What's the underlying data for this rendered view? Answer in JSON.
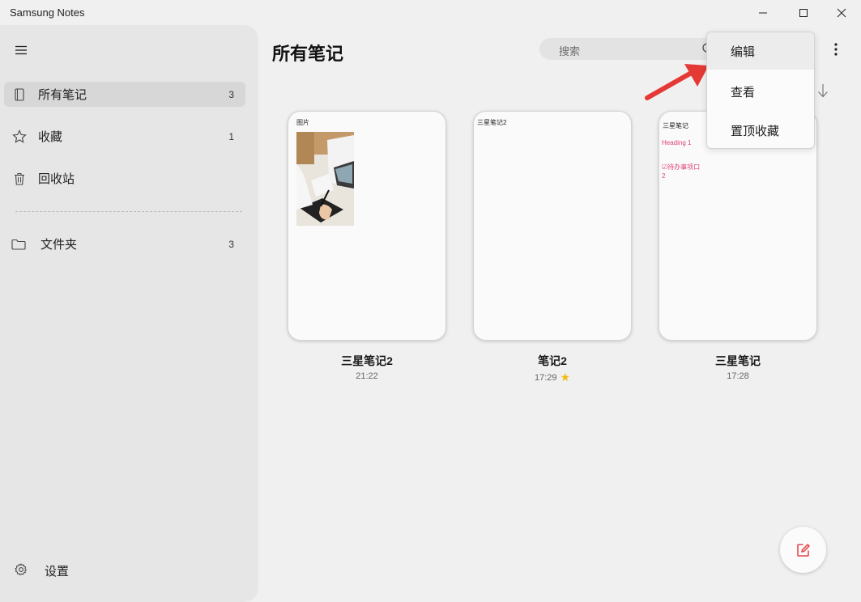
{
  "window": {
    "title": "Samsung Notes"
  },
  "sidebar": {
    "items": [
      {
        "label": "所有笔记",
        "count": "3",
        "icon": "notebook-icon"
      },
      {
        "label": "收藏",
        "count": "1",
        "icon": "star-icon"
      },
      {
        "label": "回收站",
        "count": "",
        "icon": "trash-icon"
      },
      {
        "label": "文件夹",
        "count": "3",
        "icon": "folder-icon"
      }
    ],
    "settings_label": "设置"
  },
  "main": {
    "title": "所有笔记",
    "search_placeholder": "搜索"
  },
  "notes": [
    {
      "name": "三星笔记2",
      "time": "21:22",
      "preview_title": "图片",
      "favorite": false
    },
    {
      "name": "笔记2",
      "time": "17:29",
      "preview_title": "三星笔记2",
      "favorite": true
    },
    {
      "name": "三星笔记",
      "time": "17:28",
      "preview_title": "三星笔记",
      "preview_heading": "Heading 1",
      "preview_todo": "☑待办事项口2",
      "favorite": false
    }
  ],
  "popup_menu": {
    "items": [
      "编辑",
      "查看",
      "置顶收藏"
    ]
  },
  "colors": {
    "accent_pink": "#e0407a",
    "star": "#f2bb13",
    "annotation_arrow": "#e53935"
  }
}
